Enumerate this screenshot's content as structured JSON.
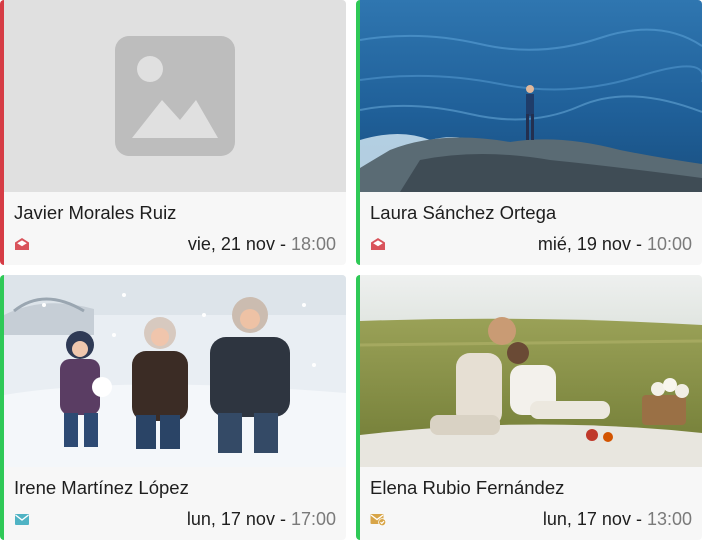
{
  "cards": [
    {
      "name": "Javier Morales Ruiz",
      "date": "vie, 21 nov",
      "separator": " - ",
      "time": "18:00",
      "status_icon": "envelope-open-icon",
      "accent": "#d63c45",
      "image": "placeholder-image-icon"
    },
    {
      "name": "Laura Sánchez Ortega",
      "date": "mié, 19 nov",
      "separator": " - ",
      "time": "10:00",
      "status_icon": "envelope-open-icon",
      "accent": "#2fc957",
      "image": "photo-person-on-coastal-rocks"
    },
    {
      "name": "Irene Martínez López",
      "date": "lun, 17 nov",
      "separator": " - ",
      "time": "17:00",
      "status_icon": "envelope-icon",
      "accent": "#2fc957",
      "image": "photo-family-in-snow"
    },
    {
      "name": "Elena Rubio Fernández",
      "date": "lun, 17 nov",
      "separator": " - ",
      "time": "13:00",
      "status_icon": "envelope-check-icon",
      "accent": "#2fc957",
      "image": "photo-couple-picnic-field"
    }
  ],
  "colors": {
    "red_accent": "#d63c45",
    "green_accent": "#2fc957",
    "envelope_red": "#d9535b",
    "envelope_teal": "#4fb3c4",
    "envelope_gold": "#d8a548"
  }
}
